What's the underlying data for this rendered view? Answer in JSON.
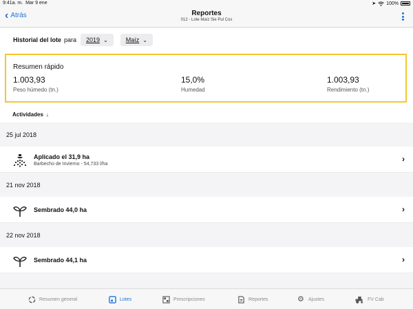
{
  "status": {
    "time": "9:41a. m.",
    "date": "Mar 9 ene",
    "battery": "100%"
  },
  "nav": {
    "back_label": "Atrás",
    "title": "Reportes",
    "subtitle": "012 - Lote Maíz Sie Pul Cos"
  },
  "filter": {
    "label": "Historial del lote",
    "para": "para",
    "year": "2019",
    "crop": "Maíz"
  },
  "summary": {
    "title": "Resumen rápido",
    "metrics": [
      {
        "value": "1.003,93",
        "label": "Peso húmedo (tn.)"
      },
      {
        "value": "15,0%",
        "label": "Humedad"
      },
      {
        "value": "1.003,93",
        "label": "Rendimiento (tn.)"
      }
    ]
  },
  "activities": {
    "header": "Actividades",
    "arrow": "↓",
    "groups": [
      {
        "date": "25 jul 2018",
        "title": "Aplicado el 31,9 ha",
        "detail": "Barbecho de Invierno - 54,733 l/ha",
        "icon": "sprayer-icon"
      },
      {
        "date": "21 nov 2018",
        "title": "Sembrado 44,0 ha",
        "icon": "seedling-icon"
      },
      {
        "date": "22 nov 2018",
        "title": "Sembrado 44,1 ha",
        "icon": "seedling-icon"
      }
    ]
  },
  "tabs": [
    {
      "label": "Resumen general",
      "icon": "overview-icon"
    },
    {
      "label": "Lotes",
      "icon": "fields-icon",
      "active": true
    },
    {
      "label": "Prescripciones",
      "icon": "prescriptions-icon"
    },
    {
      "label": "Reportes",
      "icon": "reports-icon"
    },
    {
      "label": "Ajustes",
      "icon": "gear-icon"
    },
    {
      "label": "FV Cab",
      "icon": "tractor-icon"
    }
  ],
  "colors": {
    "accent": "#1a73d9",
    "highlight": "#f5c62a"
  }
}
